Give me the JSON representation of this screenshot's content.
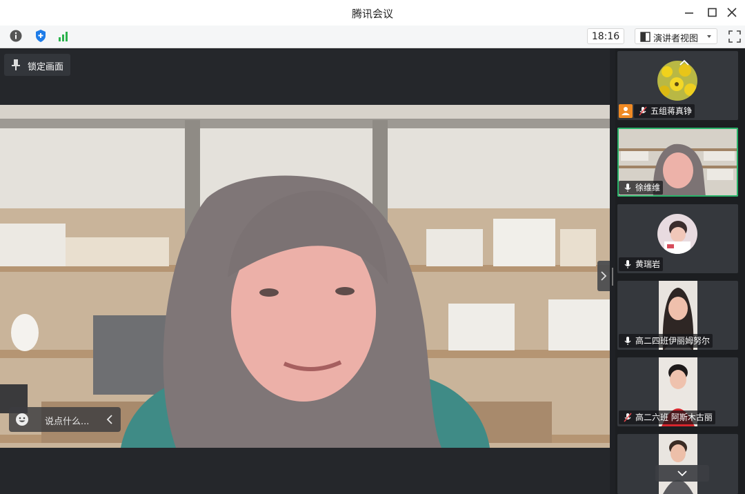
{
  "window": {
    "title": "腾讯会议"
  },
  "toolbar": {
    "time": "18:16",
    "view_label": "演讲者视图"
  },
  "stage": {
    "lock_label": "锁定画面",
    "chat_placeholder": "说点什么..."
  },
  "participants": [
    {
      "name": "五组蒋真铮",
      "mic": "muted",
      "sharing": true
    },
    {
      "name": "徐维维",
      "mic": "on",
      "active": true
    },
    {
      "name": "黄瑞岩",
      "mic": "on"
    },
    {
      "name": "高二四班伊丽姆努尔",
      "mic": "on"
    },
    {
      "name": "高二六班 阿斯木古丽",
      "mic": "muted"
    },
    {
      "name": "",
      "mic": "on"
    }
  ],
  "colors": {
    "accent_green": "#29b36a",
    "share_orange": "#f08a24",
    "shield_blue": "#1e7ce8",
    "signal_green": "#2bb24c"
  },
  "icons": [
    "info-icon",
    "shield-icon",
    "signal-icon",
    "minimize-icon",
    "maximize-icon",
    "close-icon",
    "layout-icon",
    "chevron-down-icon",
    "fullscreen-icon",
    "pin-icon",
    "emoji-icon",
    "chevron-left-icon",
    "chevron-right-icon",
    "mic-icon",
    "mic-muted-icon",
    "screen-share-icon"
  ]
}
